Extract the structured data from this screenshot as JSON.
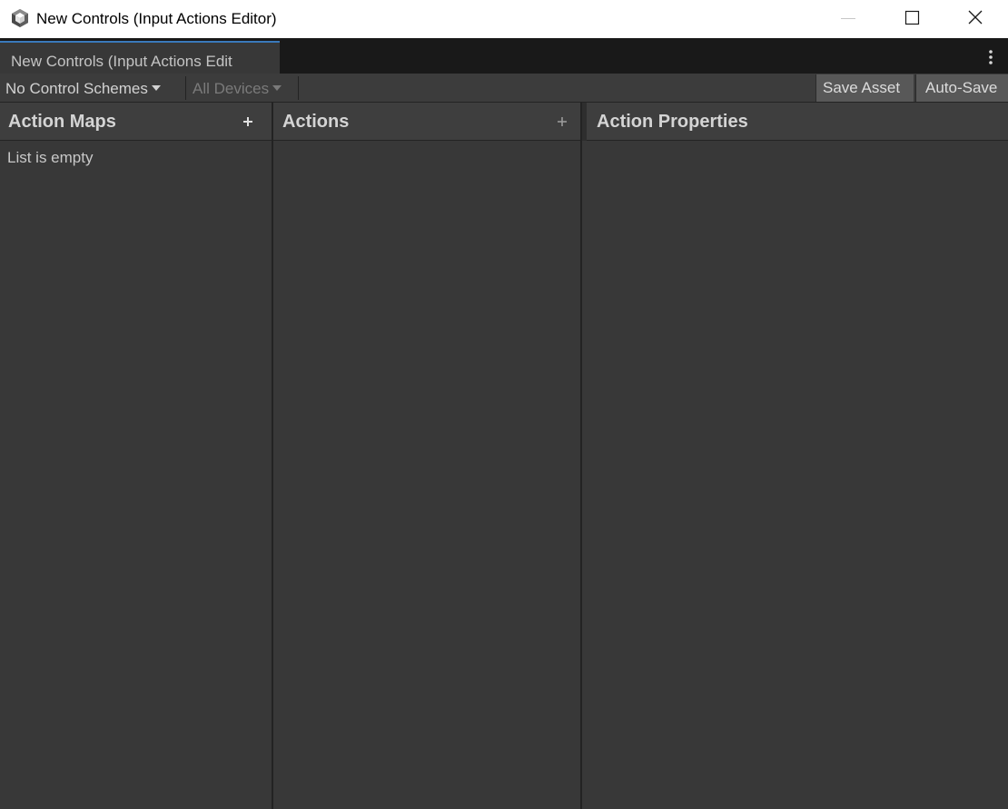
{
  "window": {
    "title": "New Controls (Input Actions Editor)",
    "icon": "unity-cube-icon"
  },
  "tabbar": {
    "tab_label": "New Controls (Input Actions Edit",
    "menu_icon": "kebab-menu-icon"
  },
  "toolbar": {
    "control_schemes": "No Control Schemes",
    "devices": "All Devices",
    "save_asset": "Save Asset",
    "auto_save": "Auto-Save"
  },
  "panes": {
    "action_maps": {
      "title": "Action Maps",
      "empty_text": "List is empty"
    },
    "actions": {
      "title": "Actions"
    },
    "action_properties": {
      "title": "Action Properties"
    }
  },
  "colors": {
    "background": "#383838",
    "tab_accent": "#3a79bb",
    "tabbar_bg": "#191919",
    "toolbar_bg": "#3c3c3c",
    "text_primary": "#d4d4d4",
    "text_disabled": "#7a7a7a"
  }
}
